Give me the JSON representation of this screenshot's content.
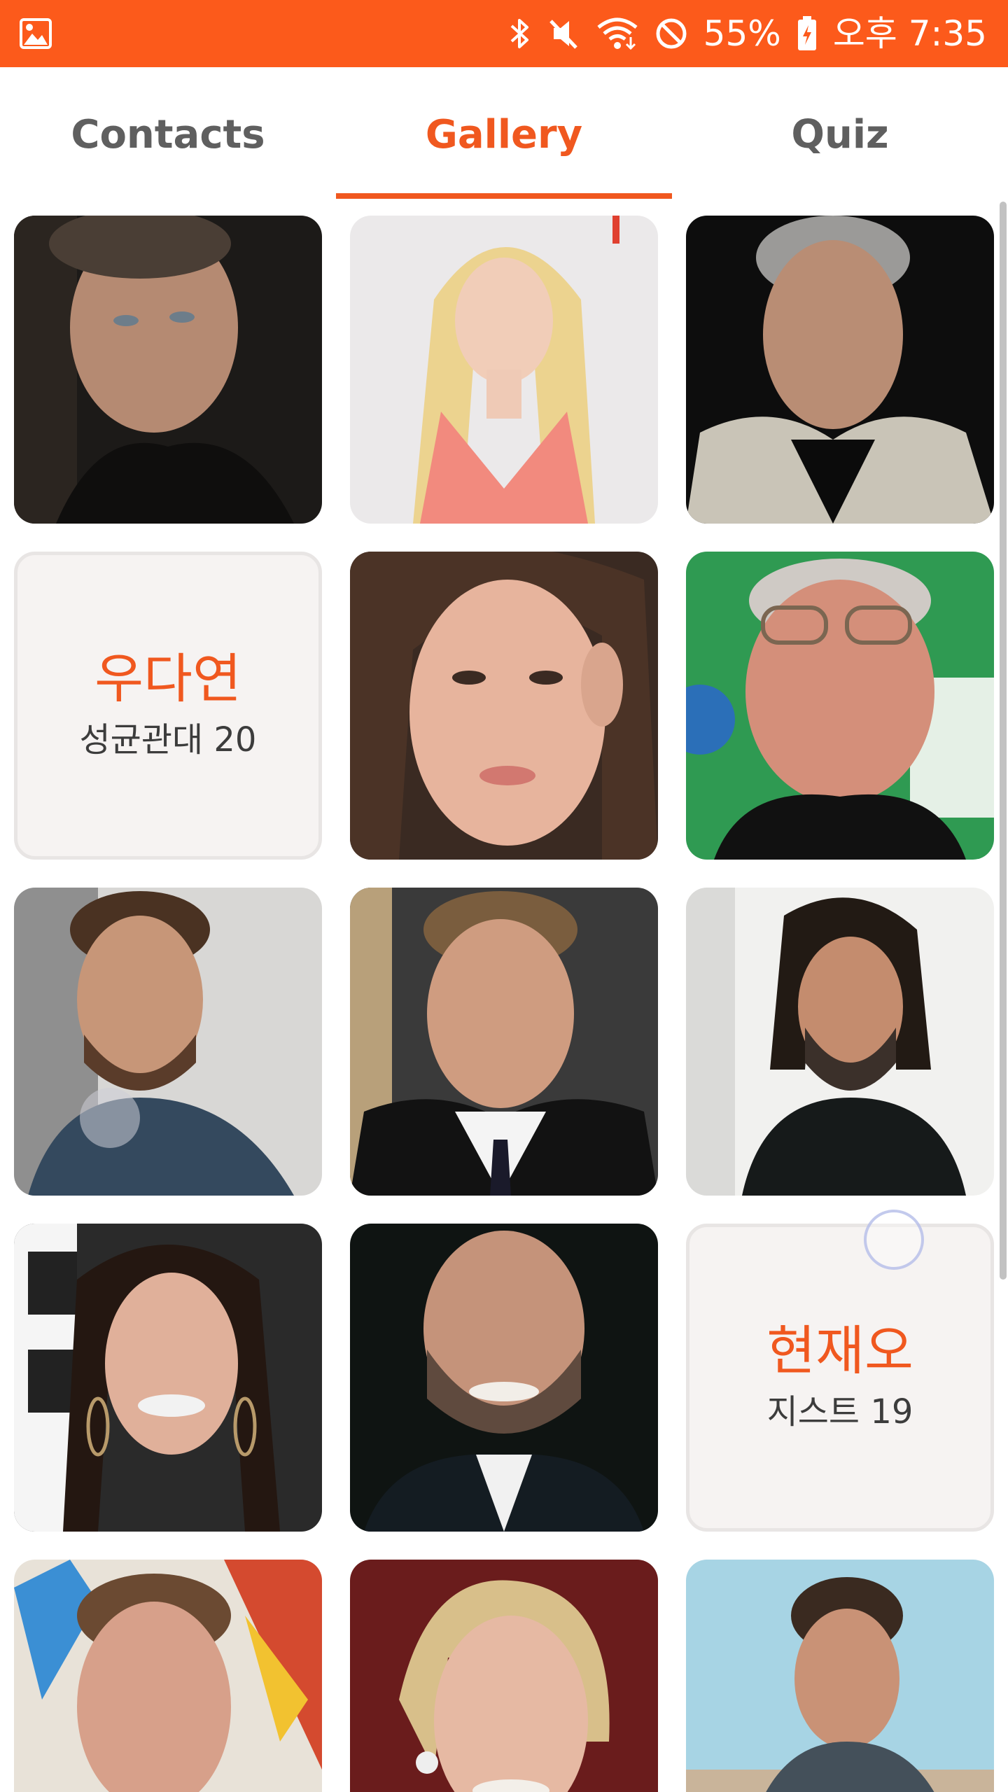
{
  "status_bar": {
    "battery": "55%",
    "time": "오후 7:35",
    "icons": [
      "gallery-image-icon",
      "bluetooth-icon",
      "mute-icon",
      "wifi-icon",
      "do-not-disturb-icon",
      "battery-charging-icon"
    ]
  },
  "tabs": [
    {
      "label": "Contacts",
      "active": false
    },
    {
      "label": "Gallery",
      "active": true
    },
    {
      "label": "Quiz",
      "active": false
    }
  ],
  "gallery": {
    "cards": [
      {
        "name": "우다연",
        "sub": "성균관대 20"
      },
      {
        "name": "현재오",
        "sub": "지스트 19"
      }
    ]
  },
  "colors": {
    "accent": "#f0581f",
    "status_bar": "#fc5a1b",
    "card_bg": "#f6f3f2"
  }
}
